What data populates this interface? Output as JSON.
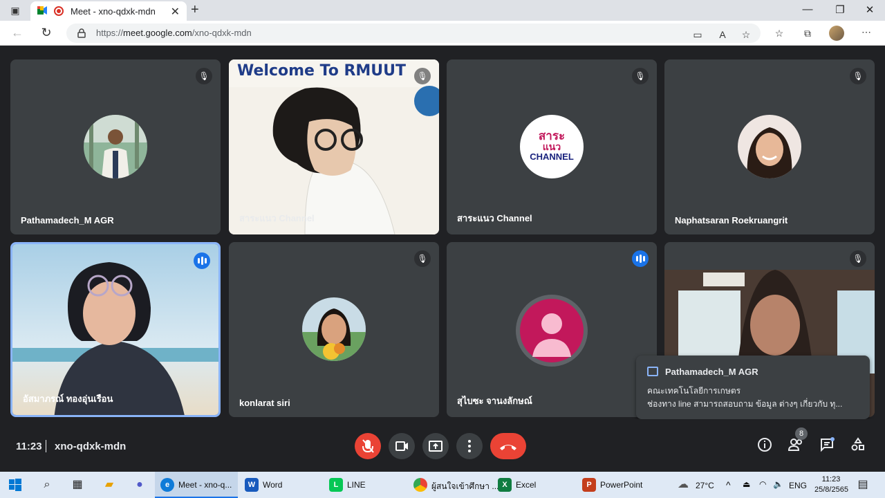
{
  "browser": {
    "tab_title": "Meet - xno-qdxk-mdn",
    "url_prefix": "https://",
    "url_domain": "meet.google.com",
    "url_path": "/xno-qdxk-mdn",
    "window_controls": {
      "minimize": "—",
      "restore": "❐",
      "close": "✕"
    },
    "new_tab": "+",
    "tab_close": "✕"
  },
  "participants": [
    {
      "name": "Pathamadech_M AGR",
      "muted": true
    },
    {
      "name": "สาระแนว Channel",
      "muted": true,
      "banner": "Welcome To RMUUT"
    },
    {
      "name": "สาระแนว Channel",
      "muted": true,
      "logo_line1": "สาระ",
      "logo_line2": "แนว",
      "logo_line3": "CHANNEL"
    },
    {
      "name": "Naphatsaran Roekruangrit",
      "muted": true
    },
    {
      "name": "อัสมาภรณ์ ทองอุ่นเรือน",
      "muted": false,
      "speaking": true
    },
    {
      "name": "konlarat siri",
      "muted": true
    },
    {
      "name": "สุไบซะ จานงลักษณ์",
      "muted": false,
      "speaking": true
    },
    {
      "name": "",
      "muted": true
    }
  ],
  "chat_toast": {
    "sender": "Pathamadech_M AGR",
    "line1": "คณะเทคโนโลยีการเกษตร",
    "line2": "ช่องทาง line สามารถสอบถาม ข้อมูล ต่างๆ เกี่ยวกับ ทุ..."
  },
  "meeting_bar": {
    "time": "11:23",
    "meeting_code": "xno-qdxk-mdn",
    "people_count": "8"
  },
  "taskbar": {
    "apps": [
      {
        "label": "Meet - xno-q...",
        "active": true
      },
      {
        "label": "Word"
      },
      {
        "label": "LINE"
      },
      {
        "label": "ผู้สนใจเข้าศึกษา ..."
      },
      {
        "label": "Excel"
      },
      {
        "label": "PowerPoint"
      }
    ],
    "weather": "27°C",
    "lang": "ENG",
    "clock_time": "11:23",
    "clock_date": "25/8/2565"
  },
  "colors": {
    "meet_bg": "#202124",
    "tile_bg": "#3c4043",
    "mic_off_red": "#ea4335",
    "speaking_blue": "#1a73e8",
    "active_border": "#8ab4f8"
  }
}
